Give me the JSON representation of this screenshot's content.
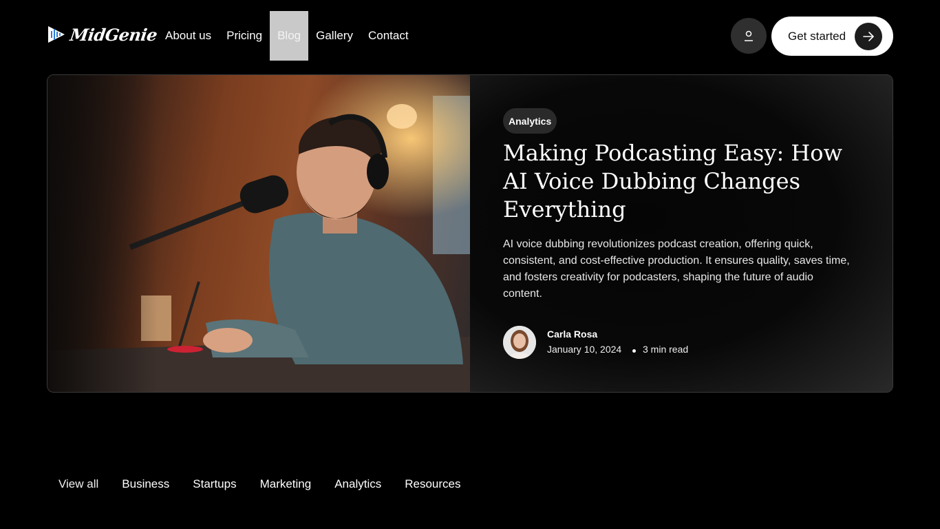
{
  "brand": {
    "name": "MidGenie",
    "logo_icon": "sound-wave-logo-icon"
  },
  "nav": {
    "items": [
      {
        "label": "About us"
      },
      {
        "label": "Pricing"
      },
      {
        "label": "Blog",
        "active": true
      },
      {
        "label": "Gallery"
      },
      {
        "label": "Contact"
      }
    ]
  },
  "header": {
    "user_icon": "user-icon",
    "cta_label": "Get started",
    "cta_icon": "arrow-right-icon"
  },
  "featured": {
    "category": "Analytics",
    "title": "Making Podcasting Easy: How AI Voice Dubbing Changes Everything",
    "excerpt": "AI voice dubbing revolutionizes podcast creation, offering quick, consistent, and cost-effective production. It ensures quality, saves time, and fosters creativity for podcasters, shaping the future of audio content.",
    "author": "Carla Rosa",
    "date": "January 10, 2024",
    "read_time": "3 min read"
  },
  "categories": [
    {
      "label": "View all"
    },
    {
      "label": "Business"
    },
    {
      "label": "Startups"
    },
    {
      "label": "Marketing"
    },
    {
      "label": "Analytics"
    },
    {
      "label": "Resources"
    }
  ],
  "colors": {
    "background": "#000000",
    "active_nav": "#c9c9c9",
    "cta_bg": "#ffffff"
  }
}
